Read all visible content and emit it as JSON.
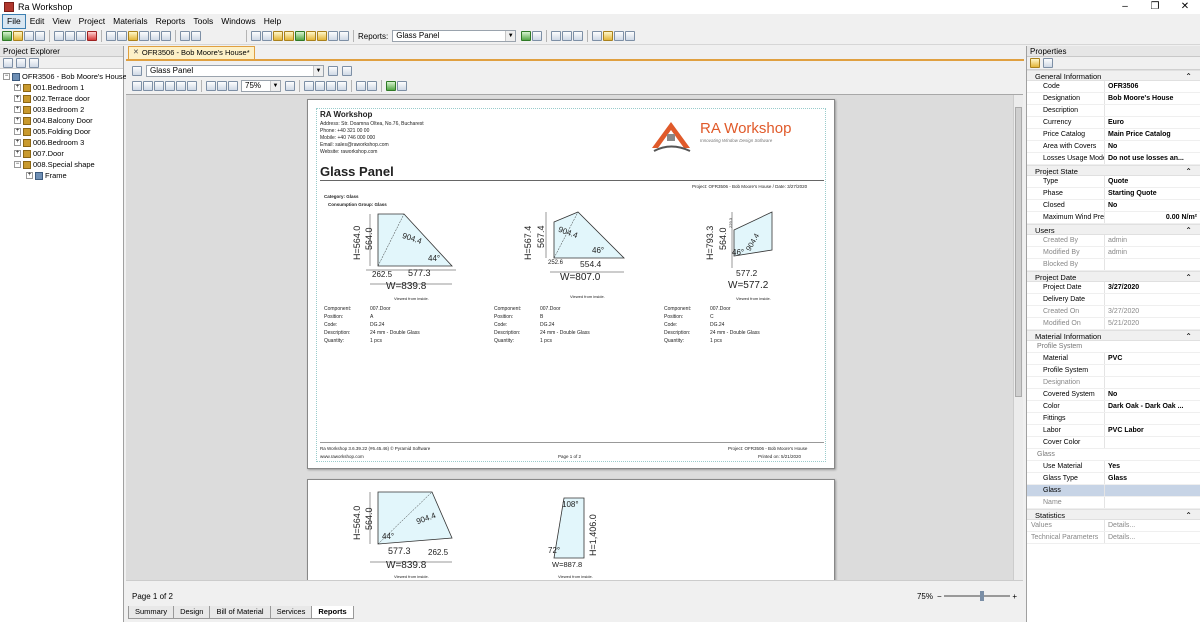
{
  "window": {
    "title": "Ra Workshop"
  },
  "menu": [
    "File",
    "Edit",
    "View",
    "Project",
    "Materials",
    "Reports",
    "Tools",
    "Windows",
    "Help"
  ],
  "toolbar": {
    "reports_label": "Reports:",
    "reports_value": "Glass Panel"
  },
  "explorer": {
    "title": "Project Explorer",
    "root": "OFR3506 - Bob Moore's House",
    "items": [
      "001.Bedroom 1",
      "002.Terrace door",
      "003.Bedroom 2",
      "004.Balcony Door",
      "005.Folding Door",
      "006.Bedroom 3",
      "007.Door",
      "008.Special shape"
    ],
    "child": "Frame"
  },
  "document": {
    "tab": "OFR3506 - Bob Moore's House*",
    "report_select": "Glass Panel",
    "zoom": "75%"
  },
  "report": {
    "company": "RA Workshop",
    "address": "Address: Str. Doamna Oltea, No.76, Bucharest",
    "phone": "Phone: +40 321 00 00",
    "mobile": "Mobile: +40 746 000 000",
    "email": "Email: sales@raworkshop.com",
    "website": "Website: raworkshop.com",
    "logo_text": "RA Workshop",
    "logo_tagline": "Innovating Window Design Software",
    "title": "Glass Panel",
    "project_line": "Project: OFR3506 - Bob Moore's House / Date: 3/27/2020",
    "category": "Category: Glass",
    "consumption": "Consumption Group: Glass",
    "viewed": "Viewed from inside.",
    "labels": {
      "component": "Component:",
      "position": "Position:",
      "code": "Code:",
      "description": "Description:",
      "quantity": "Quantity:"
    },
    "panels": [
      {
        "h1": "H=564.0",
        "h2": "564.0",
        "diag": "904.4",
        "angle": "44°",
        "w1": "262.5",
        "w2": "577.3",
        "w": "W=839.8",
        "component": "007.Door",
        "position": "A",
        "code": "DG.24",
        "description": "24 mm - Double Glass",
        "quantity": "1 pcs"
      },
      {
        "h1": "H=567.4",
        "h2": "567.4",
        "diag": "904.4",
        "angle": "46°",
        "w1": "252.6",
        "w2": "554.4",
        "w": "W=807.0",
        "component": "007.Door",
        "position": "B",
        "code": "DG.24",
        "description": "24 mm - Double Glass",
        "quantity": "1 pcs"
      },
      {
        "h1": "H=793.3",
        "h2": "564.0",
        "h3": "229.3",
        "diag": "904.4",
        "angle": "46°",
        "w2": "577.2",
        "w": "W=577.2",
        "component": "007.Door",
        "position": "C",
        "code": "DG.24",
        "description": "24 mm - Double Glass",
        "quantity": "1 pcs"
      }
    ],
    "footer_left1": "Ra Workshop 3.6.39.22 (#6.45.46) © Pyramid Software",
    "footer_left2": "www.raworkshop.com",
    "footer_center": "Page 1 of 2",
    "footer_right1": "Project: OFR3506 - Bob Moore's House",
    "footer_right2": "Printed on: 5/21/2020",
    "page2_panels": [
      {
        "h1": "H=564.0",
        "h2": "564.0",
        "diag": "904.4",
        "angle": "44°",
        "w1": "577.3",
        "w2": "262.5",
        "w": "W=839.8"
      },
      {
        "top": "108°",
        "h1": "H=1,406.0",
        "angle": "72°",
        "w": "W=887.8"
      }
    ]
  },
  "status": {
    "page": "Page 1 of 2",
    "zoom": "75%"
  },
  "tabs": [
    "Summary",
    "Design",
    "Bill of Material",
    "Services",
    "Reports"
  ],
  "properties": {
    "title": "Properties",
    "general": {
      "title": "General Information",
      "rows": [
        [
          "Code",
          "OFR3506"
        ],
        [
          "Designation",
          "Bob Moore's House"
        ],
        [
          "Description",
          ""
        ],
        [
          "Currency",
          "Euro"
        ],
        [
          "Price Catalog",
          "Main Price Catalog"
        ],
        [
          "Area with Covers",
          "No"
        ],
        [
          "Losses Usage Mode",
          "Do not use losses an..."
        ]
      ]
    },
    "state": {
      "title": "Project State",
      "rows": [
        [
          "Type",
          "Quote"
        ],
        [
          "Phase",
          "Starting Quote"
        ],
        [
          "Closed",
          "No"
        ],
        [
          "Maximum Wind Pressur",
          "0.00 N/m²"
        ]
      ]
    },
    "users": {
      "title": "Users",
      "rows": [
        [
          "Created By",
          "admin"
        ],
        [
          "Modified By",
          "admin"
        ],
        [
          "Blocked By",
          ""
        ]
      ]
    },
    "date": {
      "title": "Project Date",
      "rows": [
        [
          "Project Date",
          "3/27/2020"
        ],
        [
          "Delivery Date",
          ""
        ],
        [
          "Created On",
          "3/27/2020"
        ],
        [
          "Modified On",
          "5/21/2020"
        ]
      ]
    },
    "material": {
      "title": "Material Information",
      "profile": "Profile System",
      "rows": [
        [
          "Material",
          "PVC"
        ],
        [
          "Profile System",
          ""
        ],
        [
          "Designation",
          ""
        ],
        [
          "Covered System",
          "No"
        ],
        [
          "Color",
          "Dark Oak - Dark Oak ..."
        ],
        [
          "Fittings",
          ""
        ],
        [
          "Labor",
          "PVC Labor"
        ],
        [
          "Cover Color",
          ""
        ]
      ],
      "glass": "Glass",
      "glass_rows": [
        [
          "Use Material",
          "Yes"
        ],
        [
          "Glass Type",
          "Glass"
        ],
        [
          "Glass",
          ""
        ],
        [
          "Name",
          ""
        ]
      ]
    },
    "stats": {
      "title": "Statistics",
      "rows": [
        [
          "Values",
          "Details..."
        ],
        [
          "Technical Parameters",
          "Details..."
        ]
      ]
    }
  }
}
